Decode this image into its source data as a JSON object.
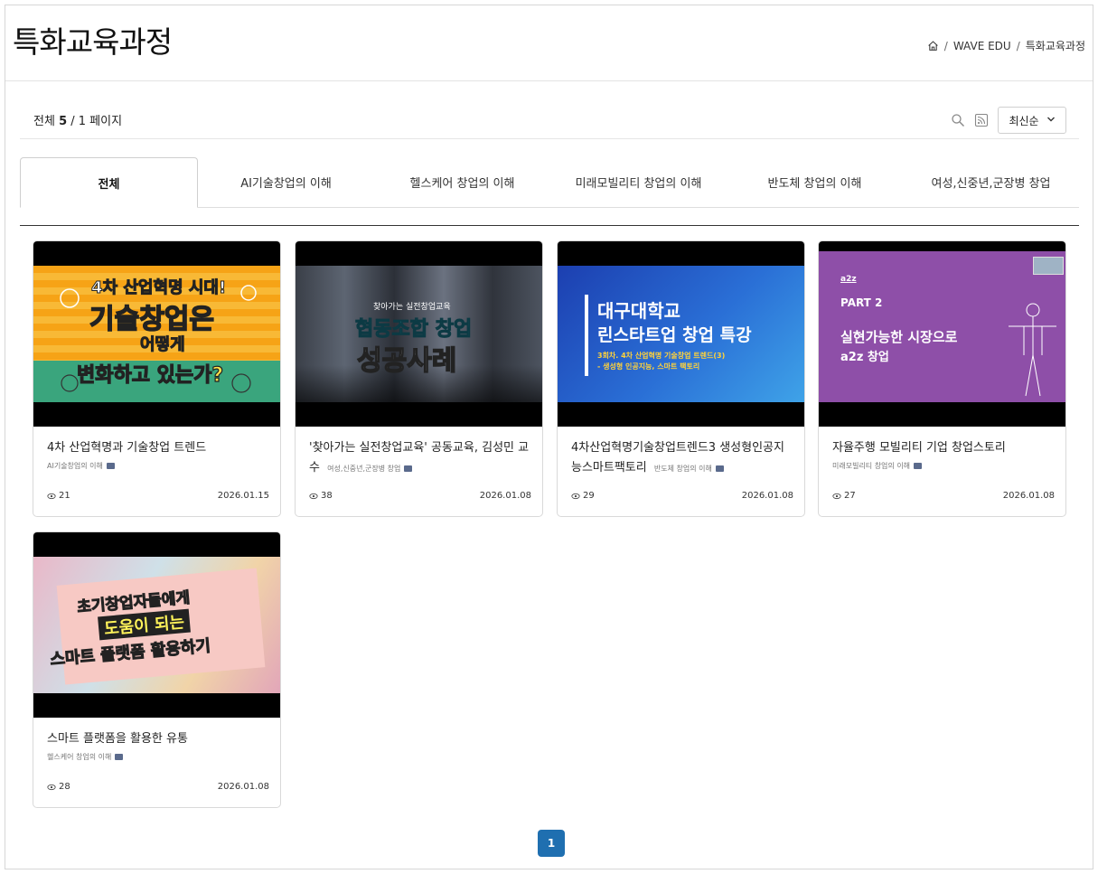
{
  "page": {
    "title": "특화교육과정",
    "breadcrumb": [
      "WAVE EDU",
      "특화교육과정"
    ]
  },
  "toolbar": {
    "count_prefix": "전체",
    "count_total": "5",
    "count_suffix": "/ 1 페이지",
    "sort_label": "최신순",
    "icons": [
      "search-icon",
      "rss-icon",
      "chevron-down-icon"
    ]
  },
  "tabs": [
    {
      "label": "전체",
      "active": true
    },
    {
      "label": "AI기술창업의 이해",
      "active": false
    },
    {
      "label": "헬스케어 창업의 이해",
      "active": false
    },
    {
      "label": "미래모빌리티 창업의 이해",
      "active": false
    },
    {
      "label": "반도체 창업의 이해",
      "active": false
    },
    {
      "label": "여성,신중년,군장병 창업",
      "active": false
    }
  ],
  "cards": [
    {
      "title": "4차 산업혁명과 기술창업 트렌드",
      "category": "AI기술창업의 이해",
      "views": "21",
      "date": "2026.01.15",
      "thumb_text": [
        "4차 산업혁명 시대!",
        "기술창업은",
        "어떻게",
        "변화하고 있는가?"
      ]
    },
    {
      "title": "'찾아가는 실전창업교육' 공동교육, 김성민 교수",
      "category": "여성,신중년,군장병 창업",
      "views": "38",
      "date": "2026.01.08",
      "thumb_text": [
        "찾아가는 실전창업교육",
        "협동조합 창업",
        "성공사례"
      ]
    },
    {
      "title": "4차산업혁명기술창업트렌드3 생성형인공지능스마트팩토리",
      "category": "반도체 창업의 이해",
      "views": "29",
      "date": "2026.01.08",
      "thumb_text": [
        "대구대학교",
        "린스타트업 창업 특강",
        "3회차. 4차 산업혁명 기술창업 트렌드(3)",
        "- 생성형 인공지능, 스마트 팩토리"
      ]
    },
    {
      "title": "자율주행 모빌리티 기업 창업스토리",
      "category": "미래모빌리티 창업의 이해",
      "views": "27",
      "date": "2026.01.08",
      "thumb_text": [
        "a2z",
        "PART 2",
        "실현가능한 시장으로",
        "a2z 창업"
      ]
    },
    {
      "title": "스마트 플랫폼을 활용한 유통",
      "category": "헬스케어 창업의 이해",
      "views": "28",
      "date": "2026.01.08",
      "thumb_text": [
        "초기창업자들에게",
        "도움이 되는",
        "스마트 플랫폼 활용하기"
      ]
    }
  ],
  "pagination": {
    "current": "1"
  },
  "colors": {
    "accent": "#1f6fb0",
    "border": "#d9d9d9"
  }
}
